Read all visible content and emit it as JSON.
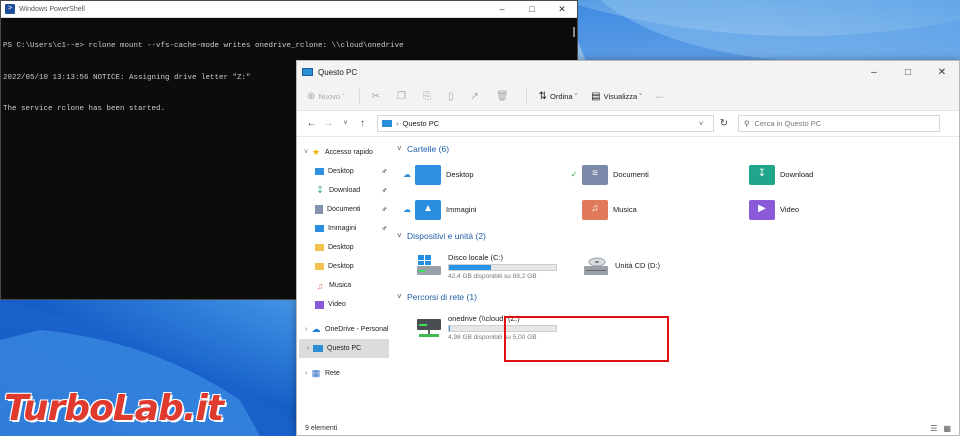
{
  "watermark": "TurboLab.it",
  "powershell": {
    "title": "Windows PowerShell",
    "lines": [
      "PS C:\\Users\\c1--e> rclone mount --vfs-cache-mode writes onedrive_rclone: \\\\cloud\\onedrive",
      "2022/05/10 13:13:56 NOTICE: Assigning drive letter \"Z:\"",
      "The service rclone has been started."
    ]
  },
  "explorer": {
    "title": "Questo PC",
    "toolbar": {
      "new_label": "Nuovo",
      "sort_label": "Ordina",
      "view_label": "Visualizza",
      "more_label": "···"
    },
    "address": {
      "path": "Questo PC"
    },
    "search": {
      "placeholder": "Cerca in Questo PC"
    },
    "sidebar": {
      "quick_access": "Accesso rapido",
      "items": [
        {
          "label": "Desktop",
          "icon": "desktop-icon",
          "pinned": true
        },
        {
          "label": "Download",
          "icon": "download-icon",
          "pinned": true
        },
        {
          "label": "Documenti",
          "icon": "documents-icon",
          "pinned": true
        },
        {
          "label": "Immagini",
          "icon": "pictures-icon",
          "pinned": true
        },
        {
          "label": "Desktop",
          "icon": "folder-icon",
          "pinned": false
        },
        {
          "label": "Desktop",
          "icon": "folder-icon",
          "pinned": false
        },
        {
          "label": "Musica",
          "icon": "music-icon",
          "pinned": false
        },
        {
          "label": "Video",
          "icon": "video-icon",
          "pinned": false
        }
      ],
      "onedrive": "OneDrive - Personal",
      "this_pc": "Questo PC",
      "network": "Rete"
    },
    "groups": {
      "folders_header": "Cartelle (6)",
      "devices_header": "Dispositivi e unità (2)",
      "network_header": "Percorsi di rete (1)"
    },
    "folders": [
      {
        "label": "Desktop",
        "icon": "desktop-folder-icon",
        "color": "#2f8fe0"
      },
      {
        "label": "Documenti",
        "icon": "documents-folder-icon",
        "color": "#7a8aa8"
      },
      {
        "label": "Download",
        "icon": "download-folder-icon",
        "color": "#1fa589"
      },
      {
        "label": "Immagini",
        "icon": "pictures-folder-icon",
        "color": "#2a8ee0"
      },
      {
        "label": "Musica",
        "icon": "music-folder-icon",
        "color": "#e07a5a"
      },
      {
        "label": "Video",
        "icon": "video-folder-icon",
        "color": "#8a5ad8"
      }
    ],
    "drives": [
      {
        "name": "Disco locale (C:)",
        "free": "42,4 GB disponibili su 69,2 GB",
        "used_fraction": 0.39
      },
      {
        "name": "Unità CD (D:)"
      }
    ],
    "network_drives": [
      {
        "name": "onedrive (\\\\cloud) (Z:)",
        "free": "4,98 GB disponibili su 5,00 GB",
        "used_fraction": 0.004
      }
    ],
    "status": {
      "items": "9 elementi"
    }
  }
}
